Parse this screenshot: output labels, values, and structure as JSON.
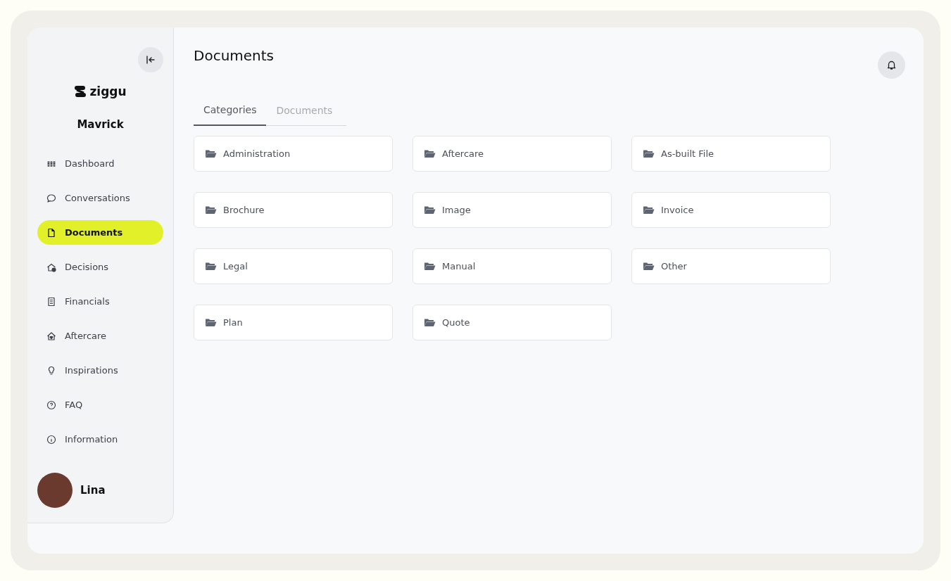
{
  "sidebar": {
    "brand": "ziggu",
    "project": "Mavrick",
    "items": [
      {
        "label": "Dashboard",
        "kind": "grid",
        "selected": false
      },
      {
        "label": "Conversations",
        "kind": "chat",
        "selected": false
      },
      {
        "label": "Documents",
        "kind": "file",
        "selected": true
      },
      {
        "label": "Decisions",
        "kind": "house-check",
        "selected": false
      },
      {
        "label": "Financials",
        "kind": "receipt",
        "selected": false
      },
      {
        "label": "Aftercare",
        "kind": "house-heart",
        "selected": false
      },
      {
        "label": "Inspirations",
        "kind": "bulb",
        "selected": false
      },
      {
        "label": "FAQ",
        "kind": "question",
        "selected": false
      },
      {
        "label": "Information",
        "kind": "info",
        "selected": false
      }
    ],
    "user": {
      "name": "Lina"
    }
  },
  "page": {
    "title": "Documents"
  },
  "tabs": [
    {
      "label": "Categories",
      "selected": true
    },
    {
      "label": "Documents",
      "selected": false
    }
  ],
  "categories": [
    "Administration",
    "Aftercare",
    "As-built File",
    "Brochure",
    "Image",
    "Invoice",
    "Legal",
    "Manual",
    "Other",
    "Plan",
    "Quote"
  ]
}
